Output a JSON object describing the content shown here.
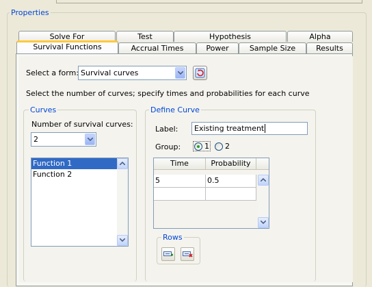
{
  "properties": {
    "title": "Properties"
  },
  "tabs_back": [
    {
      "label": "Solve For"
    },
    {
      "label": "Test"
    },
    {
      "label": "Hypothesis"
    },
    {
      "label": "Alpha"
    }
  ],
  "tabs_front": [
    {
      "label": "Survival Functions",
      "active": true
    },
    {
      "label": "Accrual Times"
    },
    {
      "label": "Power"
    },
    {
      "label": "Sample Size"
    },
    {
      "label": "Results"
    }
  ],
  "form": {
    "select_label": "Select a form:",
    "select_value": "Survival curves",
    "instruction": "Select the number of curves; specify times and probabilities for each curve"
  },
  "curves": {
    "title": "Curves",
    "number_label": "Number of survival curves:",
    "number_value": "2",
    "items": [
      "Function 1",
      "Function 2"
    ],
    "selected_index": 0
  },
  "define_curve": {
    "title": "Define Curve",
    "label_caption": "Label:",
    "label_value": "Existing treatment",
    "group_caption": "Group:",
    "group_options": [
      "1",
      "2"
    ],
    "group_selected": "1",
    "table": {
      "headers": [
        "Time",
        "Probability"
      ],
      "rows": [
        [
          "5",
          "0.5"
        ],
        [
          "",
          ""
        ]
      ]
    },
    "rows_group": {
      "title": "Rows"
    }
  },
  "icons": {
    "refresh": "refresh-icon",
    "add_row": "add-row-icon",
    "delete_row": "delete-row-icon"
  },
  "colors": {
    "accent_blue": "#0046d5",
    "selection": "#316ac5",
    "active_tab_highlight": "#ffc83c"
  }
}
